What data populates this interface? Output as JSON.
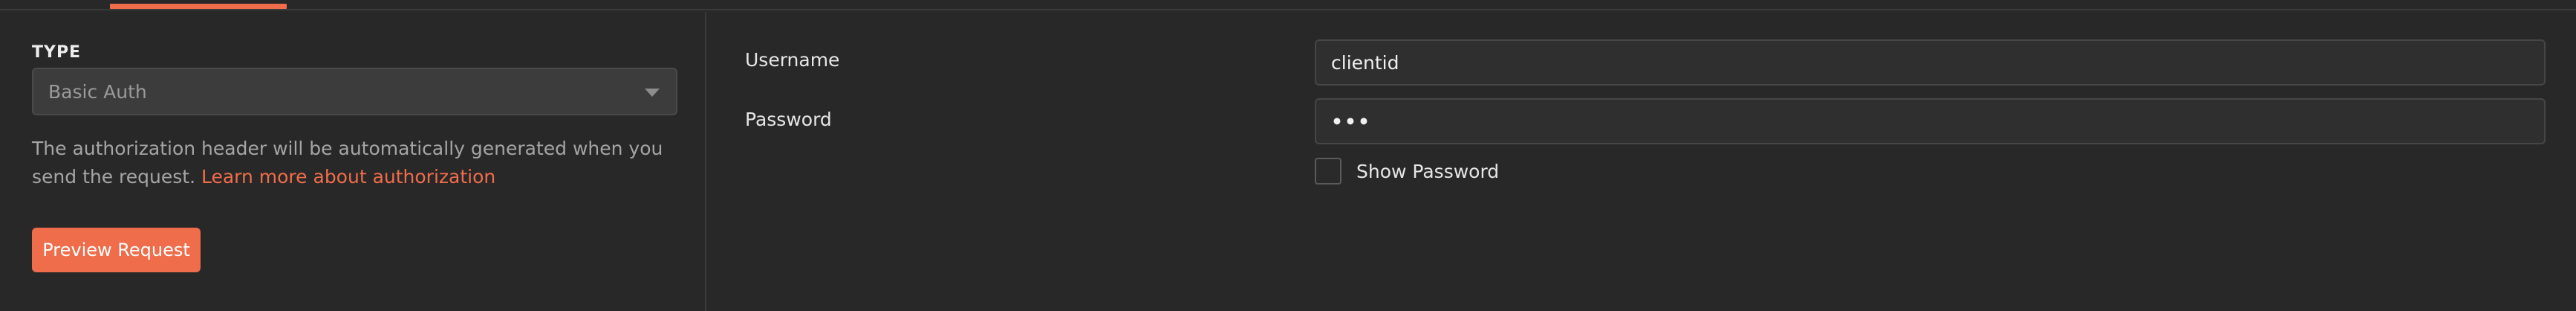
{
  "auth": {
    "type_label": "TYPE",
    "type_value": "Basic Auth",
    "description_text": "The authorization header will be automatically generated when you send the request. ",
    "learn_more_link": "Learn more about authorization",
    "preview_button": "Preview Request"
  },
  "fields": {
    "username_label": "Username",
    "username_value": "clientid",
    "password_label": "Password",
    "password_value": "•••",
    "show_password_label": "Show Password"
  },
  "colors": {
    "accent": "#ef6d4b",
    "background": "#282828"
  }
}
